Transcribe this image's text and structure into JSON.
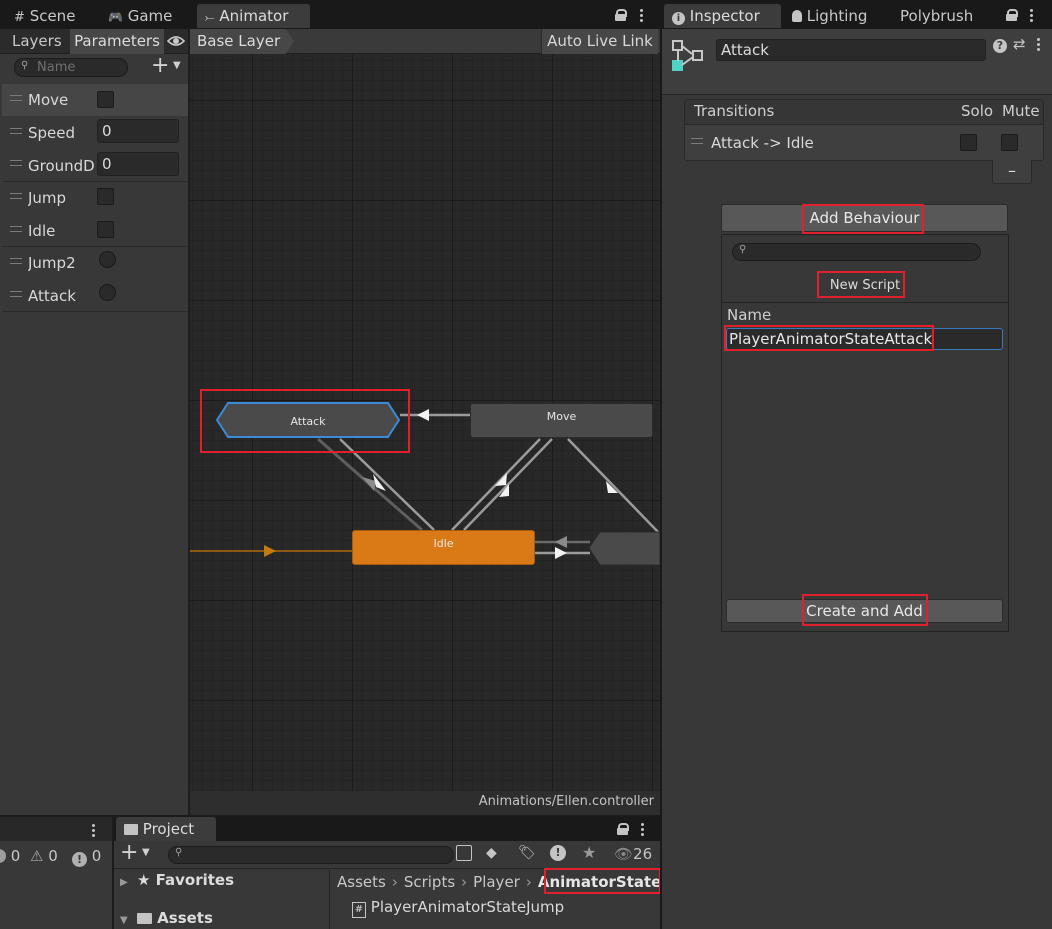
{
  "tabs_left": {
    "scene": "Scene",
    "game": "Game",
    "animator": "Animator"
  },
  "animator": {
    "subtabs": {
      "layers": "Layers",
      "parameters": "Parameters"
    },
    "layer_breadcrumb": "Base Layer",
    "auto_live_link": "Auto Live Link",
    "search_placeholder": "Name",
    "footer_path": "Animations/Ellen.controller",
    "parameters": [
      {
        "name": "Move",
        "type": "bool"
      },
      {
        "name": "Speed",
        "type": "float",
        "value": "0"
      },
      {
        "name": "GroundDi",
        "type": "float",
        "value": "0"
      },
      {
        "name": "Jump",
        "type": "bool"
      },
      {
        "name": "Idle",
        "type": "bool"
      },
      {
        "name": "Jump2",
        "type": "trigger"
      },
      {
        "name": "Attack",
        "type": "trigger"
      }
    ],
    "states": {
      "attack": "Attack",
      "move": "Move",
      "idle": "Idle"
    }
  },
  "tabs_right": {
    "inspector": "Inspector",
    "lighting": "Lighting",
    "polybrush": "Polybrush"
  },
  "inspector": {
    "state_name": "Attack",
    "transitions_header": "Transitions",
    "solo": "Solo",
    "mute": "Mute",
    "transition_item": "Attack -> Idle",
    "remove_symbol": "–",
    "add_behaviour": "Add Behaviour",
    "new_script": "New Script",
    "name_label": "Name",
    "name_value": "PlayerAnimatorStateAttack",
    "create_and_add": "Create and Add"
  },
  "console": {
    "info_count": "0",
    "warn_count": "0",
    "error_count": "0"
  },
  "project": {
    "tab": "Project",
    "favorites": "Favorites",
    "assets": "Assets",
    "hidden_count": "26",
    "breadcrumb": [
      "Assets",
      "Scripts",
      "Player",
      "AnimatorState"
    ],
    "files": [
      "PlayerAnimatorStateJump"
    ]
  },
  "colors": {
    "highlight_red": "#e0202c",
    "idle_orange": "#d97a16",
    "selected_blue": "#3d8ad7",
    "accent_teal": "#4fd3c4"
  }
}
